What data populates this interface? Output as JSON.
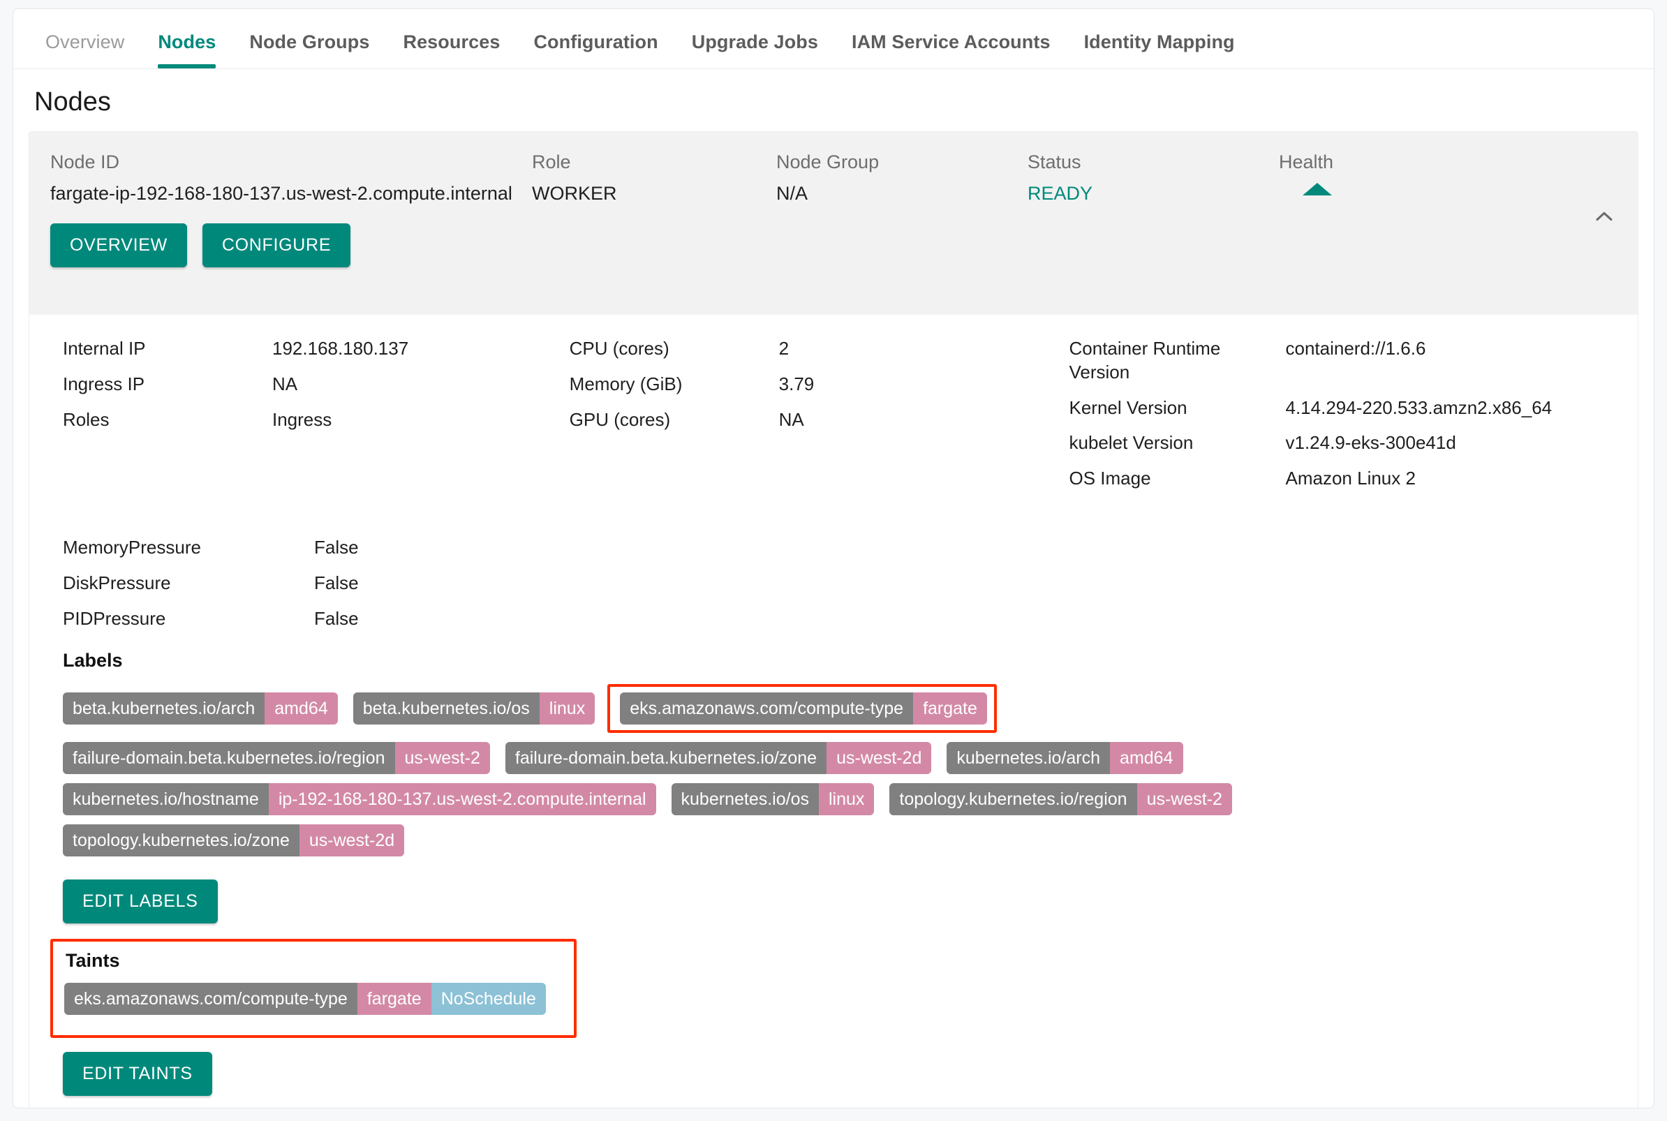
{
  "tabs": [
    {
      "label": "Overview",
      "state": "muted"
    },
    {
      "label": "Nodes",
      "state": "active"
    },
    {
      "label": "Node Groups",
      "state": "normal"
    },
    {
      "label": "Resources",
      "state": "normal"
    },
    {
      "label": "Configuration",
      "state": "normal"
    },
    {
      "label": "Upgrade Jobs",
      "state": "normal"
    },
    {
      "label": "IAM Service Accounts",
      "state": "normal"
    },
    {
      "label": "Identity Mapping",
      "state": "normal"
    }
  ],
  "page_title": "Nodes",
  "node_header": {
    "node_id_label": "Node ID",
    "node_id_value": "fargate-ip-192-168-180-137.us-west-2.compute.internal",
    "role_label": "Role",
    "role_value": "WORKER",
    "node_group_label": "Node Group",
    "node_group_value": "N/A",
    "status_label": "Status",
    "status_value": "READY",
    "health_label": "Health",
    "health_icon": "triangle-up-icon",
    "collapse_icon": "chevron-up-icon",
    "overview_button": "OVERVIEW",
    "configure_button": "CONFIGURE"
  },
  "details": {
    "column_a": [
      {
        "key": "Internal IP",
        "value": "192.168.180.137"
      },
      {
        "key": "Ingress IP",
        "value": "NA"
      },
      {
        "key": "Roles",
        "value": "Ingress"
      }
    ],
    "column_b": [
      {
        "key": "CPU (cores)",
        "value": "2"
      },
      {
        "key": "Memory (GiB)",
        "value": "3.79"
      },
      {
        "key": "GPU (cores)",
        "value": "NA"
      }
    ],
    "column_c": [
      {
        "key": "Container Runtime Version",
        "value": "containerd://1.6.6"
      },
      {
        "key": "Kernel Version",
        "value": "4.14.294-220.533.amzn2.x86_64"
      },
      {
        "key": "kubelet Version",
        "value": "v1.24.9-eks-300e41d"
      },
      {
        "key": "OS Image",
        "value": "Amazon Linux 2"
      }
    ],
    "pressures": [
      {
        "key": "MemoryPressure",
        "value": "False"
      },
      {
        "key": "DiskPressure",
        "value": "False"
      },
      {
        "key": "PIDPressure",
        "value": "False"
      }
    ]
  },
  "labels_section": {
    "title": "Labels",
    "edit_button": "EDIT LABELS",
    "rows": [
      [
        {
          "key": "beta.kubernetes.io/arch",
          "value": "amd64",
          "highlighted": false
        },
        {
          "key": "beta.kubernetes.io/os",
          "value": "linux",
          "highlighted": false
        },
        {
          "key": "eks.amazonaws.com/compute-type",
          "value": "fargate",
          "highlighted": true
        }
      ],
      [
        {
          "key": "failure-domain.beta.kubernetes.io/region",
          "value": "us-west-2",
          "highlighted": false
        },
        {
          "key": "failure-domain.beta.kubernetes.io/zone",
          "value": "us-west-2d",
          "highlighted": false
        },
        {
          "key": "kubernetes.io/arch",
          "value": "amd64",
          "highlighted": false
        }
      ],
      [
        {
          "key": "kubernetes.io/hostname",
          "value": "ip-192-168-180-137.us-west-2.compute.internal",
          "highlighted": false
        },
        {
          "key": "kubernetes.io/os",
          "value": "linux",
          "highlighted": false
        },
        {
          "key": "topology.kubernetes.io/region",
          "value": "us-west-2",
          "highlighted": false
        }
      ],
      [
        {
          "key": "topology.kubernetes.io/zone",
          "value": "us-west-2d",
          "highlighted": false
        }
      ]
    ]
  },
  "taints_section": {
    "title": "Taints",
    "edit_button": "EDIT TAINTS",
    "taints": [
      {
        "key": "eks.amazonaws.com/compute-type",
        "value": "fargate",
        "effect": "NoSchedule"
      }
    ]
  },
  "colors": {
    "accent": "#00897b",
    "chip_key": "#808080",
    "chip_value": "#d389a5",
    "chip_effect": "#8cc1d6",
    "highlight_outline": "#ff2d00",
    "status_ready": "#00897b"
  }
}
